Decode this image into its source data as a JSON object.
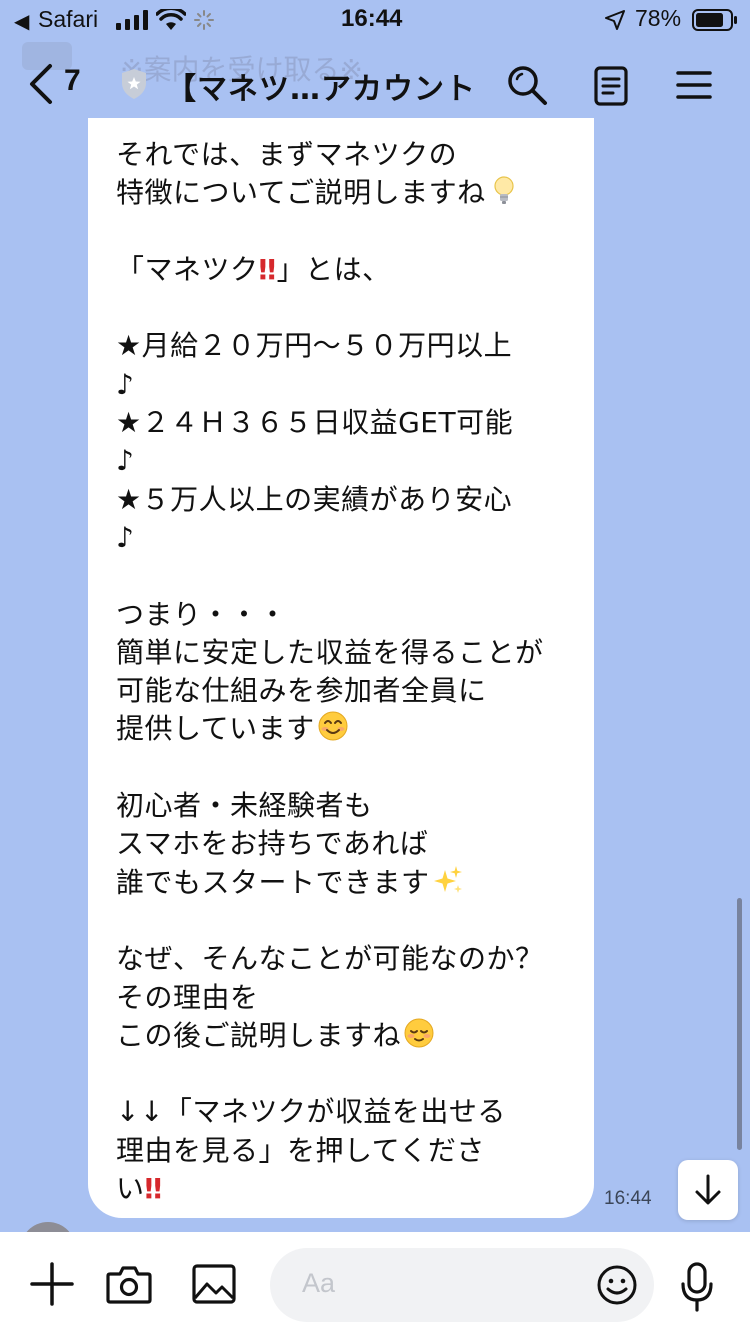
{
  "status_bar": {
    "back_app": "Safari",
    "time": "16:44",
    "battery_percent": "78%"
  },
  "header": {
    "unread_count": "7",
    "title": "【マネツ…アカウント",
    "ghost_text": "※案内を受け取る※"
  },
  "message": {
    "lines": [
      "それでは、まずマネツクの",
      "特徴についてご説明しますね",
      "",
      "「マネツク",
      "",
      "★月給２０万円〜５０万円以上",
      "♪",
      "★２４Ｈ３６５日収益GET可能",
      "♪",
      "★５万人以上の実績があり安心",
      "♪",
      "",
      "つまり・・・",
      "簡単に安定した収益を得ることが",
      "可能な仕組みを参加者全員に",
      "提供しています",
      "",
      "初心者・未経験者も",
      "スマホをお持ちであれば",
      "誰でもスタートできます",
      "",
      "なぜ、そんなことが可能なのか？",
      "その理由を",
      "この後ご説明しますね",
      "",
      "↓↓「マネツクが収益を出せる",
      "理由を見る」を押してくださ",
      "い"
    ],
    "line3_suffix": "」とは、",
    "double_exclaim": "‼",
    "timestamp": "16:44"
  },
  "input_bar": {
    "placeholder": "Aa"
  },
  "colors": {
    "chat_background": "#a9c1f2",
    "bubble": "#ffffff",
    "accent_red": "#d6282c"
  },
  "icons": [
    "back-arrow-icon",
    "signal-icon",
    "wifi-icon",
    "loading-icon",
    "location-icon",
    "battery-icon",
    "chevron-left-icon",
    "shield-icon",
    "search-icon",
    "notes-icon",
    "menu-icon",
    "lightbulb-emoji",
    "double-exclamation-emoji",
    "smile-emoji",
    "sparkles-emoji",
    "relieved-emoji",
    "arrow-down-icon",
    "plus-icon",
    "camera-icon",
    "image-icon",
    "emoji-icon",
    "mic-icon"
  ]
}
